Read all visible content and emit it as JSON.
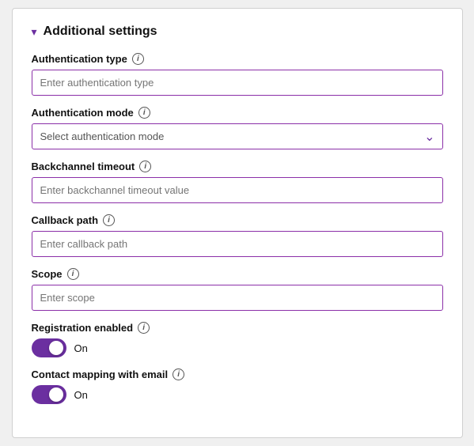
{
  "section": {
    "title": "Additional settings",
    "chevron": "▾"
  },
  "fields": {
    "auth_type": {
      "label": "Authentication type",
      "placeholder": "Enter authentication type"
    },
    "auth_mode": {
      "label": "Authentication mode",
      "placeholder": "Select authentication mode"
    },
    "backchannel_timeout": {
      "label": "Backchannel timeout",
      "placeholder": "Enter backchannel timeout value"
    },
    "callback_path": {
      "label": "Callback path",
      "placeholder": "Enter callback path"
    },
    "scope": {
      "label": "Scope",
      "placeholder": "Enter scope"
    },
    "registration_enabled": {
      "label": "Registration enabled",
      "toggle_value": "On"
    },
    "contact_mapping": {
      "label": "Contact mapping with email",
      "toggle_value": "On"
    }
  }
}
